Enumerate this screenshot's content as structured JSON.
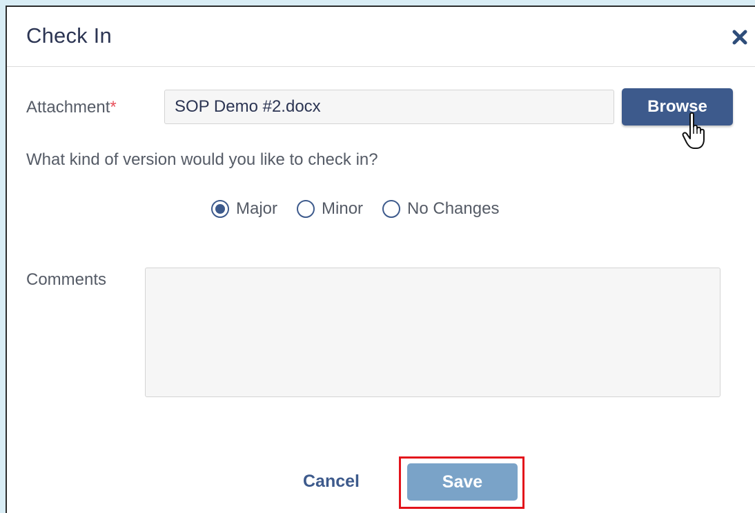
{
  "dialog": {
    "title": "Check In",
    "close_icon": "close-icon"
  },
  "attachment": {
    "label": "Attachment",
    "required_marker": "*",
    "value": "SOP Demo #2.docx",
    "browse_label": "Browse"
  },
  "version": {
    "question": "What kind of version would you like to check in?",
    "options": [
      {
        "label": "Major",
        "selected": true
      },
      {
        "label": "Minor",
        "selected": false
      },
      {
        "label": "No Changes",
        "selected": false
      }
    ]
  },
  "comments": {
    "label": "Comments",
    "value": ""
  },
  "footer": {
    "cancel_label": "Cancel",
    "save_label": "Save"
  },
  "colors": {
    "primary": "#3d5a8c",
    "save_button": "#7aa3c8",
    "highlight": "#e3131b",
    "required": "#e8505b"
  }
}
